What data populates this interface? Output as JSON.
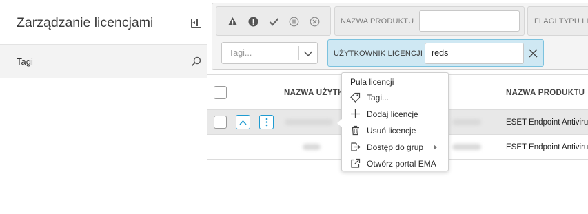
{
  "sidebar": {
    "title": "Zarządzanie licencjami",
    "tags_label": "Tagi"
  },
  "filters": {
    "status_icons": [
      "warning-icon",
      "error-icon",
      "check-icon",
      "pause-icon",
      "cancel-icon"
    ],
    "product_name_label": "NAZWA PRODUKTU",
    "product_name_value": "",
    "flags_label": "FLAGI TYPU LIC",
    "tags_placeholder": "Tagi...",
    "license_user_label": "UŻYTKOWNIK LICENCJI",
    "license_user_value": "reds"
  },
  "table": {
    "headers": {
      "user": "NAZWA UŻYTK",
      "product": "NAZWA PRODUKTU"
    },
    "rows": [
      {
        "product": "ESET Endpoint Antiviru",
        "selected": true
      },
      {
        "product": "ESET Endpoint Antiviru",
        "selected": false
      }
    ]
  },
  "context_menu": {
    "header": "Pula licencji",
    "items": [
      {
        "label": "Tagi...",
        "icon": "tag-icon"
      },
      {
        "label": "Dodaj licencje",
        "icon": "plus-icon"
      },
      {
        "label": "Usuń licencje",
        "icon": "trash-icon"
      },
      {
        "label": "Dostęp do grup",
        "icon": "group-access-icon"
      },
      {
        "label": "Otwórz portal EMA",
        "icon": "external-link-icon"
      }
    ]
  },
  "colors": {
    "accent": "#1f9bd1",
    "active_filter_bg": "#cfe8f3",
    "active_filter_border": "#7cc2de"
  }
}
